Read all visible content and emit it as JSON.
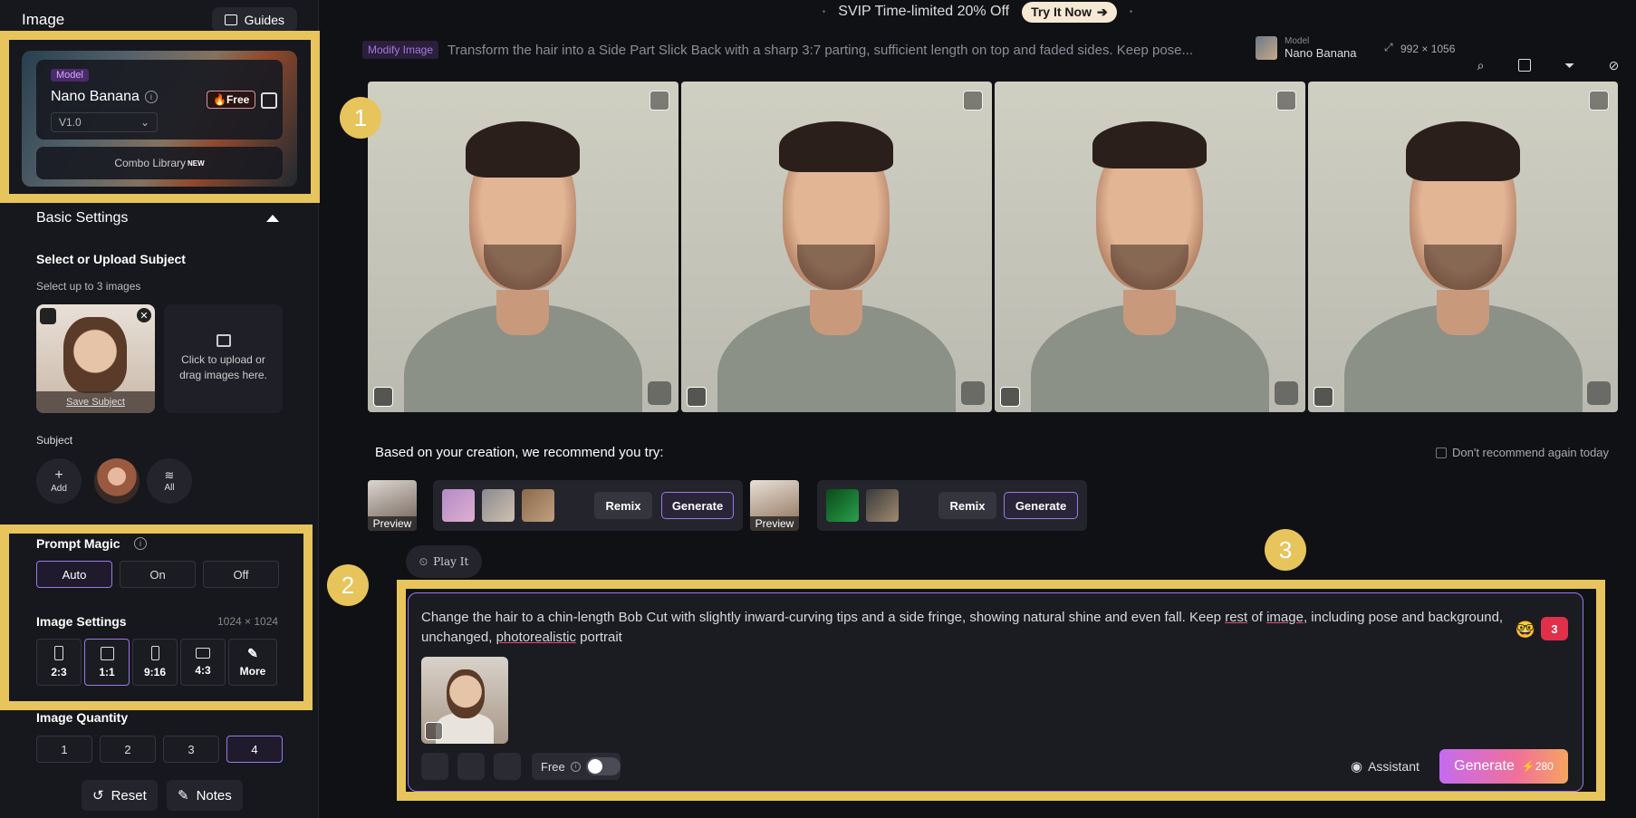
{
  "sidebar": {
    "title": "Image",
    "guides_label": "Guides",
    "model": {
      "tag": "Model",
      "name": "Nano Banana",
      "free_badge": "🔥Free",
      "version": "V1.0",
      "combo_label": "Combo Library",
      "combo_new": "NEW"
    },
    "basic_settings": "Basic Settings",
    "subject_title": "Select or Upload Subject",
    "subject_hint": "Select up to 3 images",
    "save_subject": "Save Subject",
    "upload_text": "Click to upload or drag images here.",
    "subject_label": "Subject",
    "add_label": "Add",
    "all_label": "All",
    "prompt_magic": {
      "title": "Prompt Magic",
      "options": [
        "Auto",
        "On",
        "Off"
      ],
      "selected": "Auto"
    },
    "image_settings": {
      "title": "Image Settings",
      "size": "1024 × 1024",
      "ratios": [
        "2:3",
        "1:1",
        "9:16",
        "4:3",
        "More"
      ],
      "selected": "1:1"
    },
    "image_quantity": {
      "title": "Image Quantity",
      "options": [
        "1",
        "2",
        "3",
        "4"
      ],
      "selected": "4"
    },
    "reset_label": "Reset",
    "notes_label": "Notes"
  },
  "banner": {
    "text": "SVIP Time-limited 20% Off",
    "cta": "Try It Now"
  },
  "task": {
    "tag": "Modify Image",
    "prompt": "Transform the hair into a Side Part Slick Back with a sharp 3:7 parting, sufficient length on top and faded sides. Keep pose...",
    "model_label": "Model",
    "model_name": "Nano Banana",
    "size": "992 × 1056"
  },
  "recommend": {
    "title": "Based on your creation, we recommend you try:",
    "dont_recommend": "Don't recommend again today",
    "preview_label": "Preview",
    "remix_label": "Remix",
    "generate_label": "Generate"
  },
  "play_it": "Play It",
  "prompt": {
    "text_before": "Change the hair to a chin-length Bob Cut with slightly inward-curving tips and a side fringe, showing natural shine and even fall. Keep ",
    "w1": "rest",
    "of": " of ",
    "w2": "image",
    "text_mid": ", including pose and background, unchanged, ",
    "w3": "photorealistic",
    "text_end": " portrait",
    "badge": "3",
    "free_label": "Free",
    "assistant_label": "Assistant",
    "generate_label": "Generate",
    "generate_cost": "⚡280"
  },
  "annotations": [
    "1",
    "2",
    "3"
  ],
  "colors": {
    "accent": "#9a7ae8",
    "highlight": "#e7c45c",
    "generate_gradient_start": "#c56bf0",
    "generate_gradient_end": "#f6a460"
  }
}
